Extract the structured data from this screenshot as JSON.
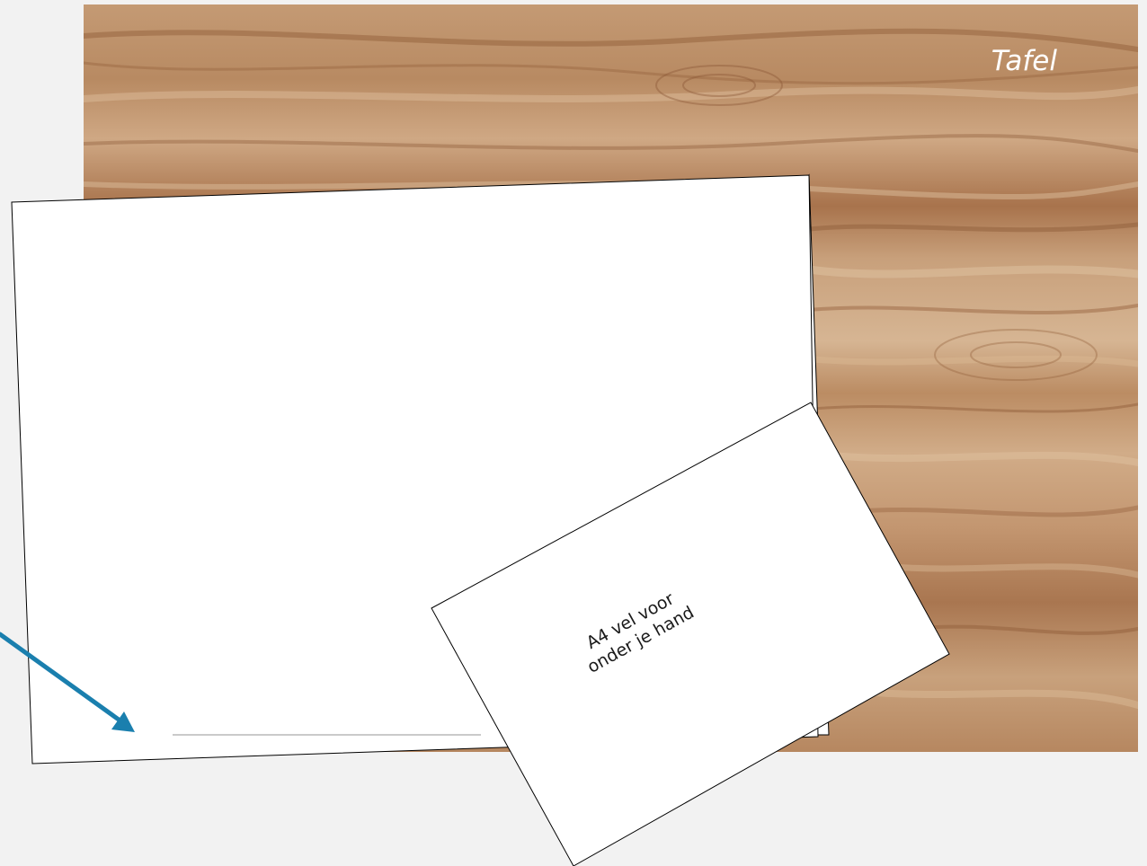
{
  "table": {
    "label": "Tafel"
  },
  "small_sheet": {
    "line1": "A4 vel voor",
    "line2": "onder je hand"
  },
  "colors": {
    "background": "#f2f2f2",
    "wood": "#c39670",
    "paper": "#ffffff",
    "arrow": "#1a7fae",
    "outline": "#000000"
  }
}
